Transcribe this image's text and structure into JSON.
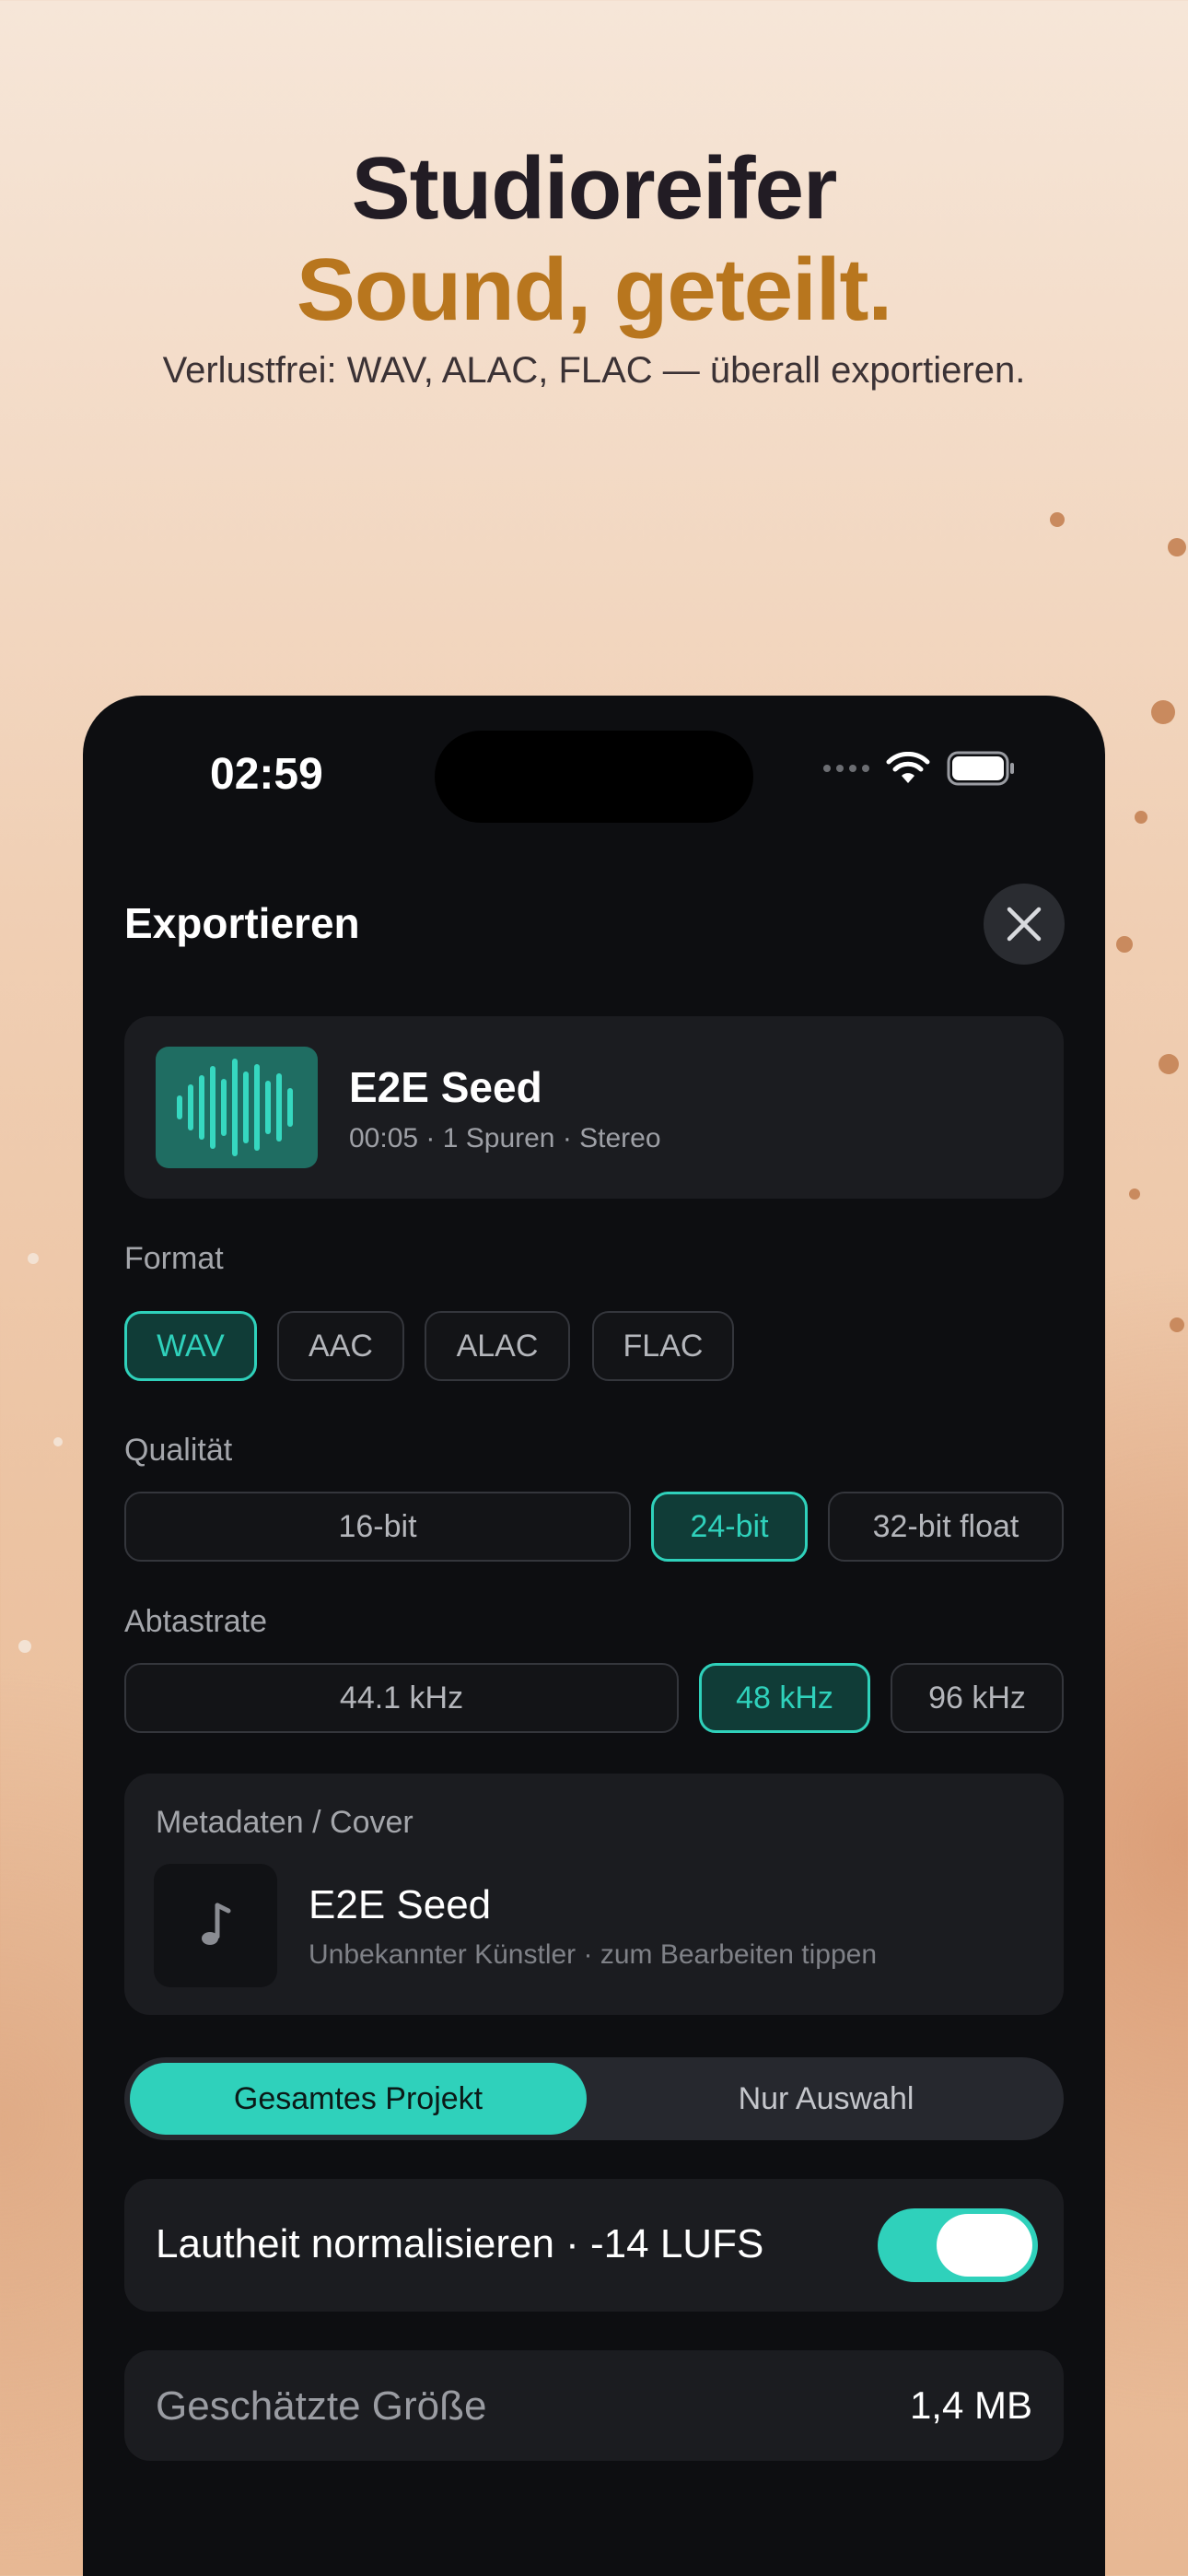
{
  "promo": {
    "headline_line1": "Studioreifer",
    "headline_line2": "Sound, geteilt.",
    "subtitle": "Verlustfrei: WAV, ALAC, FLAC — überall exportieren."
  },
  "status_bar": {
    "time": "02:59",
    "icons": [
      "signal-dots-icon",
      "wifi-icon",
      "battery-icon"
    ]
  },
  "sheet": {
    "title": "Exportieren",
    "close_icon": "close-icon"
  },
  "project": {
    "name": "E2E Seed",
    "meta": "00:05 · 1 Spuren · Stereo"
  },
  "format": {
    "label": "Format",
    "options": [
      "WAV",
      "AAC",
      "ALAC",
      "FLAC"
    ],
    "selected": "WAV"
  },
  "quality": {
    "label": "Qualität",
    "options": [
      "16-bit",
      "24-bit",
      "32-bit float"
    ],
    "selected": "24-bit"
  },
  "sample_rate": {
    "label": "Abtastrate",
    "options": [
      "44.1 kHz",
      "48 kHz",
      "96 kHz"
    ],
    "selected": "48 kHz"
  },
  "metadata": {
    "label": "Metadaten / Cover",
    "title": "E2E Seed",
    "subtitle": "Unbekannter Künstler · zum Bearbeiten tippen",
    "cover_icon": "music-note-icon"
  },
  "scope": {
    "options": [
      "Gesamtes Projekt",
      "Nur Auswahl"
    ],
    "selected": "Gesamtes Projekt"
  },
  "normalize": {
    "label": "Lautheit normalisieren · -14 LUFS",
    "enabled": true
  },
  "estimate": {
    "label": "Geschätzte Größe",
    "value": "1,4 MB"
  },
  "colors": {
    "accent": "#2fd1bb",
    "headline_accent": "#b8761e",
    "sheet_bg": "#0d0e11",
    "card_bg": "#1b1c20"
  }
}
